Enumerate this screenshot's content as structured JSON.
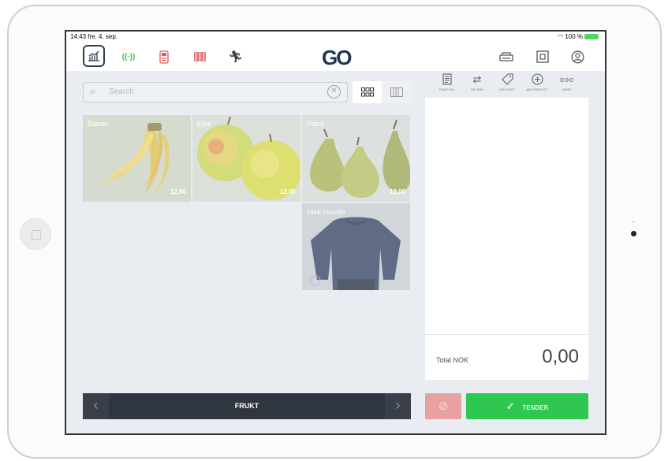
{
  "status_bar": {
    "time_date": "14:43  fre. 4. sep.",
    "battery": "100 %"
  },
  "brand": {
    "logo_text": "GO"
  },
  "topbar": {
    "left_icons": [
      "stats-icon",
      "wireless-icon",
      "terminal-icon",
      "barcode-icon",
      "runner-icon"
    ],
    "right_icons": [
      "printer-icon",
      "cash-drawer-icon",
      "user-icon"
    ]
  },
  "search": {
    "placeholder": "Search",
    "value": ""
  },
  "products": [
    {
      "name": "Banan",
      "price": "12,00"
    },
    {
      "name": "Eple",
      "price": "12,00"
    },
    {
      "name": "Pære",
      "price": "12,00"
    },
    {
      "name": "Nike Hoodie",
      "price": ""
    }
  ],
  "category": {
    "name": "FRUKT"
  },
  "actions": [
    {
      "label": "PRINT BILL",
      "icon": "receipt-icon"
    },
    {
      "label": "RETURN",
      "icon": "return-icon"
    },
    {
      "label": "DISCOUNT",
      "icon": "tag-icon"
    },
    {
      "label": "ADD PRODUCT",
      "icon": "plus-icon"
    },
    {
      "label": "MORE",
      "icon": "more-icon"
    }
  ],
  "cart": {
    "total_label": "Total NOK",
    "total_value": "0,00"
  },
  "buttons": {
    "tender": "TENDER"
  },
  "colors": {
    "brand": "#1e3354",
    "tender": "#2ec850",
    "cancel": "#e8a1a1",
    "category_bar": "#2f3640"
  }
}
